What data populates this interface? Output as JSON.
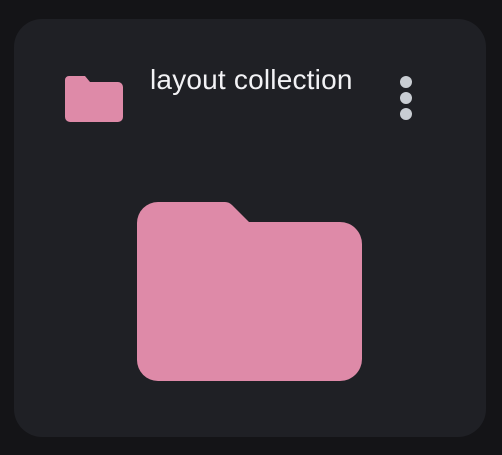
{
  "card": {
    "title": "layout collection",
    "header_icon": "folder-icon",
    "menu_icon": "more-vert-icon",
    "preview_icon": "folder-icon"
  },
  "colors": {
    "background": "#141417",
    "card": "#1f2025",
    "folder": "#de8aa8",
    "text": "#f2f2f5",
    "menu_dots": "#c9cdd3"
  }
}
